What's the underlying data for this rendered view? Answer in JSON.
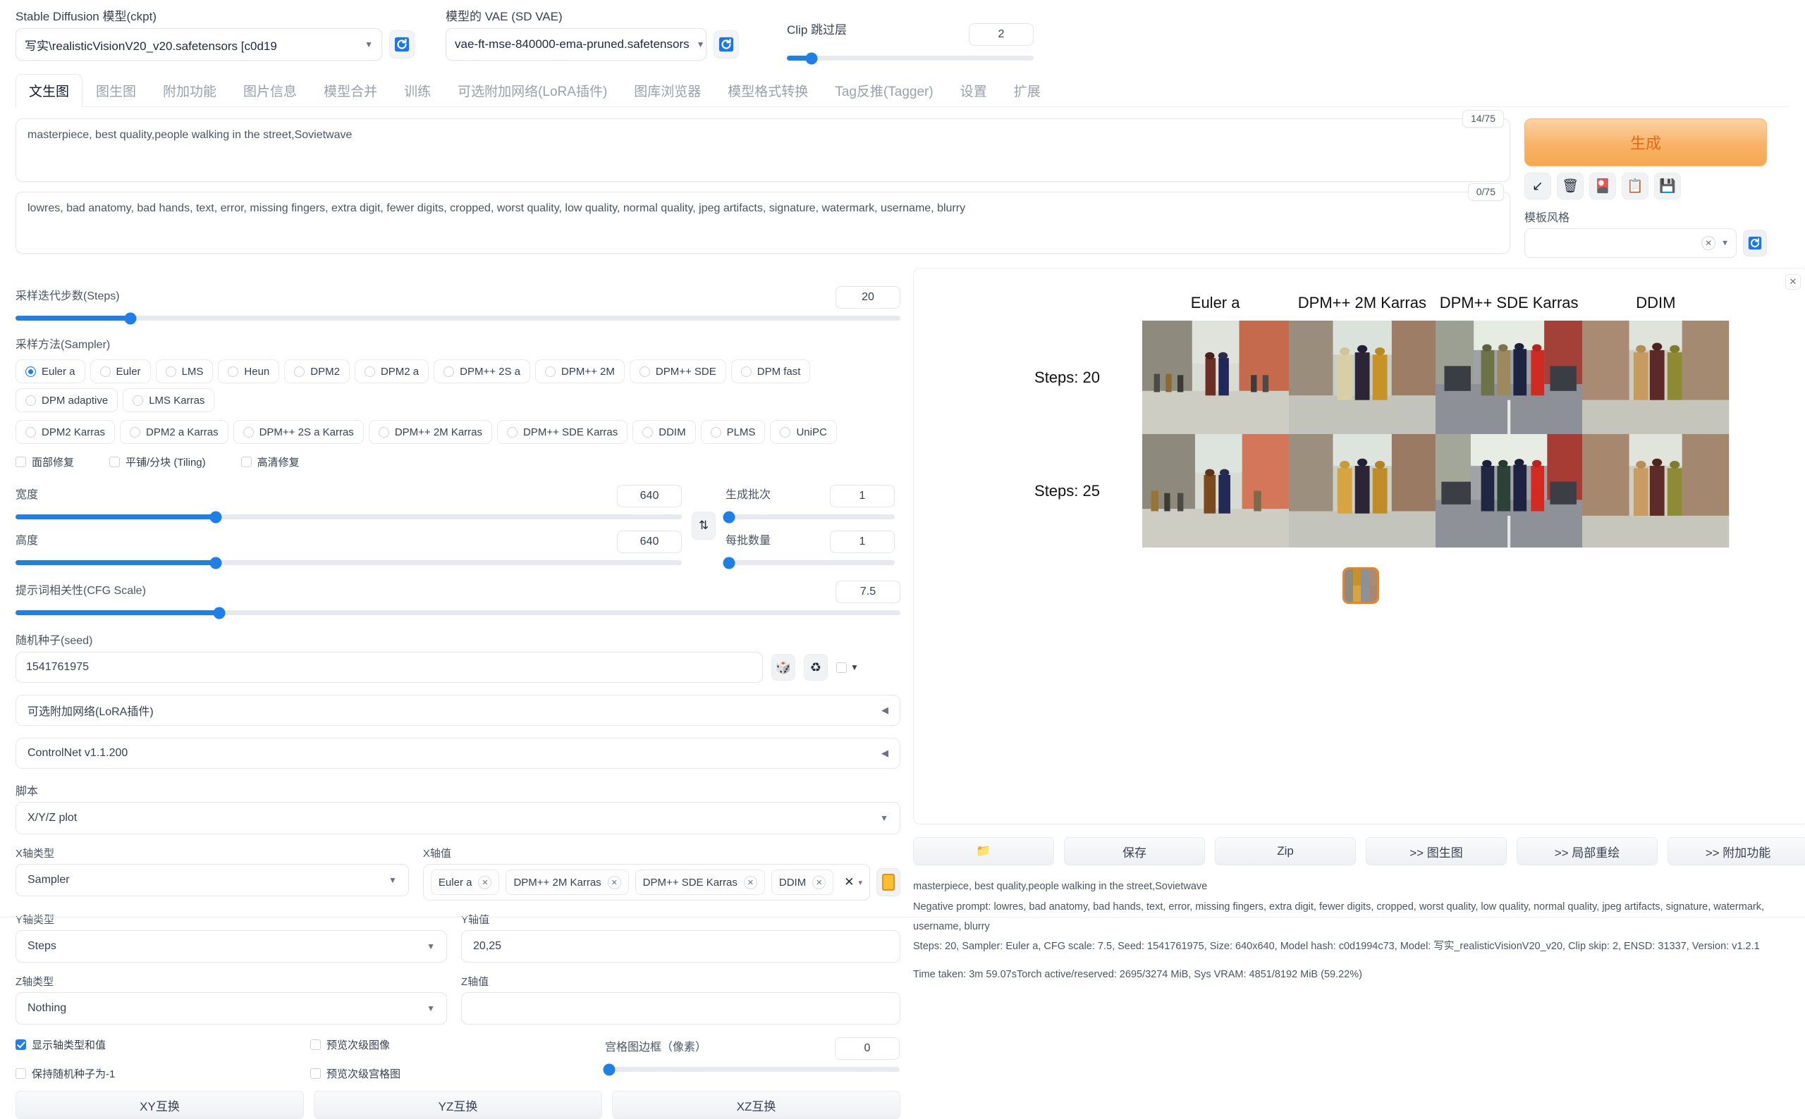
{
  "header": {
    "model_label": "Stable Diffusion 模型(ckpt)",
    "model_value": "写实\\realisticVisionV20_v20.safetensors [c0d19",
    "vae_label": "模型的 VAE (SD VAE)",
    "vae_value": "vae-ft-mse-840000-ema-pruned.safetensors",
    "clip_label": "Clip 跳过层",
    "clip_value": "2",
    "refresh_icon": "refresh-icon",
    "caret_icon": "chevron-down-icon"
  },
  "tabs": [
    {
      "label": "文生图",
      "active": true
    },
    {
      "label": "图生图",
      "active": false
    },
    {
      "label": "附加功能",
      "active": false
    },
    {
      "label": "图片信息",
      "active": false
    },
    {
      "label": "模型合并",
      "active": false
    },
    {
      "label": "训练",
      "active": false
    },
    {
      "label": "可选附加网络(LoRA插件)",
      "active": false
    },
    {
      "label": "图库浏览器",
      "active": false
    },
    {
      "label": "模型格式转换",
      "active": false
    },
    {
      "label": "Tag反推(Tagger)",
      "active": false
    },
    {
      "label": "设置",
      "active": false
    },
    {
      "label": "扩展",
      "active": false
    }
  ],
  "prompt": {
    "positive": "masterpiece, best quality,people walking in the street,Sovietwave",
    "positive_tokens": "14/75",
    "negative": "lowres, bad anatomy, bad hands, text, error, missing fingers, extra digit, fewer digits, cropped, worst quality, low quality, normal quality, jpeg artifacts, signature, watermark, username, blurry",
    "negative_tokens": "0/75"
  },
  "generate": {
    "label": "生成",
    "icons": [
      {
        "name": "arrow-down-left-icon",
        "glyph": "↙"
      },
      {
        "name": "trash-icon",
        "glyph": "🗑"
      },
      {
        "name": "extra-networks-icon",
        "glyph": "🎴"
      },
      {
        "name": "clipboard-icon",
        "glyph": "📋"
      },
      {
        "name": "save-style-icon",
        "glyph": "💾"
      }
    ],
    "style_label": "模板风格",
    "style_value": "",
    "style_clear_icon": "close-icon",
    "style_caret_icon": "chevron-down-icon",
    "style_refresh_icon": "refresh-icon"
  },
  "params": {
    "steps_label": "采样迭代步数(Steps)",
    "steps_value": "20",
    "steps_pct": 13,
    "sampler_label": "采样方法(Sampler)",
    "samplers_row1": [
      "Euler a",
      "Euler",
      "LMS",
      "Heun",
      "DPM2",
      "DPM2 a",
      "DPM++ 2S a",
      "DPM++ 2M",
      "DPM++ SDE",
      "DPM fast",
      "DPM adaptive",
      "LMS Karras"
    ],
    "samplers_row2": [
      "DPM2 Karras",
      "DPM2 a Karras",
      "DPM++ 2S a Karras",
      "DPM++ 2M Karras",
      "DPM++ SDE Karras",
      "DDIM",
      "PLMS",
      "UniPC"
    ],
    "selected_sampler": "Euler a",
    "checkboxes": [
      {
        "label": "面部修复",
        "checked": false
      },
      {
        "label": "平铺/分块 (Tiling)",
        "checked": false
      },
      {
        "label": "高清修复",
        "checked": false
      }
    ],
    "width_label": "宽度",
    "width_value": "640",
    "width_pct": 30,
    "height_label": "高度",
    "height_value": "640",
    "height_pct": 30,
    "cfg_label": "提示词相关性(CFG Scale)",
    "cfg_value": "7.5",
    "cfg_pct": 23,
    "batch_count_label": "生成批次",
    "batch_count_value": "1",
    "batch_count_pct": 0,
    "batch_size_label": "每批数量",
    "batch_size_value": "1",
    "batch_size_pct": 0,
    "swap_icon": "swap-vertical-icon",
    "seed_label": "随机种子(seed)",
    "seed_value": "1541761975",
    "seed_dice_icon": "dice-icon",
    "seed_recycle_icon": "recycle-icon",
    "seed_extra_caret": "chevron-down-icon"
  },
  "accordions": [
    {
      "label": "可选附加网络(LoRA插件)",
      "arrow": "◀"
    },
    {
      "label": "ControlNet v1.1.200",
      "arrow": "◀"
    }
  ],
  "script": {
    "label": "脚本",
    "value": "X/Y/Z plot",
    "caret_icon": "chevron-down-icon"
  },
  "xyz": {
    "x_type_label": "X轴类型",
    "x_type_value": "Sampler",
    "x_values_label": "X轴值",
    "x_values": [
      "Euler a",
      "DPM++ 2M Karras",
      "DPM++ SDE Karras",
      "DDIM"
    ],
    "x_clear_icon": "close-icon",
    "x_fill_icon": "fill-values-icon",
    "y_type_label": "Y轴类型",
    "y_type_value": "Steps",
    "y_values_label": "Y轴值",
    "y_values_value": "20,25",
    "z_type_label": "Z轴类型",
    "z_type_value": "Nothing",
    "z_values_label": "Z轴值",
    "z_values_value": "",
    "show_axis_label": "显示轴类型和值",
    "show_axis_checked": true,
    "keep_seed_label": "保持随机种子为-1",
    "keep_seed_checked": false,
    "preview_sub_images_label": "预览次级图像",
    "preview_sub_images_checked": false,
    "preview_sub_grids_label": "预览次级宫格图",
    "preview_sub_grids_checked": false,
    "margin_label": "宫格图边框（像素）",
    "margin_value": "0",
    "margin_pct": 0,
    "swap_buttons": [
      "XY互换",
      "YZ互换",
      "XZ互换"
    ]
  },
  "result": {
    "close_icon": "close-icon",
    "col_headers": [
      "Euler a",
      "DPM++ 2M Karras",
      "DPM++ SDE Karras",
      "DDIM"
    ],
    "row_headers": [
      "Steps: 20",
      "Steps: 25"
    ],
    "thumbnail_name": "xyz-grid-thumbnail",
    "buttons": [
      {
        "label": "📁",
        "name": "open-folder-button"
      },
      {
        "label": "保存",
        "name": "save-button"
      },
      {
        "label": "Zip",
        "name": "zip-button"
      },
      {
        "label": ">> 图生图",
        "name": "send-to-img2img-button"
      },
      {
        "label": ">> 局部重绘",
        "name": "send-to-inpaint-button"
      },
      {
        "label": ">> 附加功能",
        "name": "send-to-extras-button"
      }
    ],
    "info_prompt": "masterpiece, best quality,people walking in the street,Sovietwave",
    "info_negative": "Negative prompt: lowres, bad anatomy, bad hands, text, error, missing fingers, extra digit, fewer digits, cropped, worst quality, low quality, normal quality, jpeg artifacts, signature, watermark, username, blurry",
    "info_params": "Steps: 20, Sampler: Euler a, CFG scale: 7.5, Seed: 1541761975, Size: 640x640, Model hash: c0d1994c73, Model: 写实_realisticVisionV20_v20, Clip skip: 2, ENSD: 31337, Version: v1.2.1",
    "info_time": "Time taken: 3m 59.07sTorch active/reserved: 2695/3274 MiB, Sys VRAM: 4851/8192 MiB (59.22%)"
  },
  "colors": {
    "accent_blue": "#1e7fe8",
    "generate_orange": "#e4691b",
    "thumb_border": "#e8832a"
  }
}
